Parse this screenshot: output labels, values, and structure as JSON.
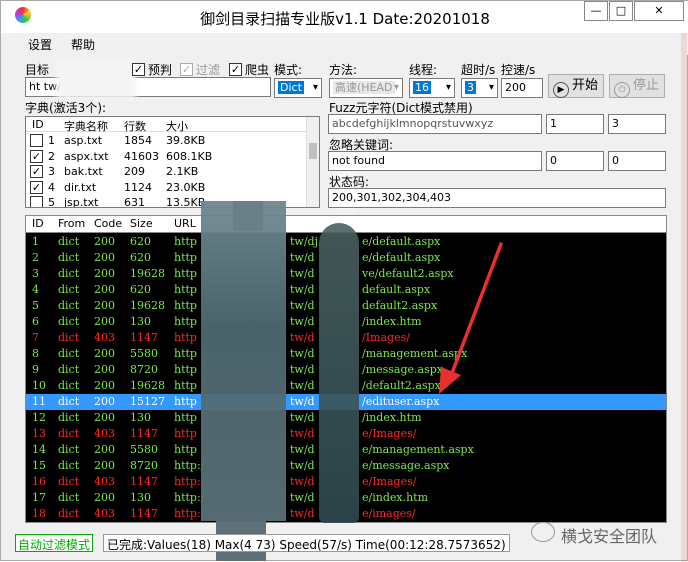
{
  "window": {
    "title": "御剑目录扫描专业版v1.1 Date:20201018",
    "min": "—",
    "max": "□",
    "close": "✕"
  },
  "menu": [
    "设置",
    "帮助"
  ],
  "target": {
    "label": "目标",
    "value": "ht                                    tw/djactive/"
  },
  "options": {
    "predict": "预判",
    "filter": "过滤",
    "crawler": "爬虫",
    "mode_label": "模式:",
    "mode_value": "Dict",
    "method_label": "方法:",
    "method_value": "高速(HEAD",
    "threads_label": "线程:",
    "threads_value": "16",
    "timeout_label": "超时/s",
    "timeout_value": "3",
    "speed_label": "控速/s",
    "speed_value": "200"
  },
  "buttons": {
    "start": "开始",
    "stop": "停止"
  },
  "dict": {
    "label": "字典(激活3个):",
    "columns": [
      "ID",
      "字典名称",
      "行数",
      "大小"
    ],
    "rows": [
      {
        "checked": false,
        "id": "1",
        "name": "asp.txt",
        "lines": "1854",
        "size": "39.8KB"
      },
      {
        "checked": true,
        "id": "2",
        "name": "aspx.txt",
        "lines": "41603",
        "size": "608.1KB"
      },
      {
        "checked": true,
        "id": "3",
        "name": "bak.txt",
        "lines": "209",
        "size": "2.1KB"
      },
      {
        "checked": true,
        "id": "4",
        "name": "dir.txt",
        "lines": "1124",
        "size": "23.0KB"
      },
      {
        "checked": false,
        "id": "5",
        "name": "jsp.txt",
        "lines": "631",
        "size": "13.5KB"
      }
    ]
  },
  "fuzz": {
    "label": "Fuzz元字符(Dict模式禁用)",
    "value": "abcdefghijklmnopqrstuvwxyz",
    "min": "1",
    "max": "3"
  },
  "ignore": {
    "label": "忽略关键词:",
    "value": "not found",
    "a": "0",
    "b": "0"
  },
  "status_codes": {
    "label": "状态码:",
    "value": "200,301,302,304,403"
  },
  "results": {
    "columns": [
      "ID",
      "From",
      "Code",
      "Size",
      "URL"
    ],
    "selected_id": "11",
    "rows": [
      {
        "id": "1",
        "from": "dict",
        "code": "200",
        "size": "620",
        "url_a": "http",
        "url_b": "tw/dj",
        "url_c": "e/default.aspx"
      },
      {
        "id": "2",
        "from": "dict",
        "code": "200",
        "size": "620",
        "url_a": "http",
        "url_b": "tw/d",
        "url_c": "e/default.aspx"
      },
      {
        "id": "3",
        "from": "dict",
        "code": "200",
        "size": "19628",
        "url_a": "http",
        "url_b": "tw/d",
        "url_c": "ve/default2.aspx"
      },
      {
        "id": "4",
        "from": "dict",
        "code": "200",
        "size": "620",
        "url_a": "http",
        "url_b": "tw/d",
        "url_c": "default.aspx"
      },
      {
        "id": "5",
        "from": "dict",
        "code": "200",
        "size": "19628",
        "url_a": "http",
        "url_b": "tw/d",
        "url_c": "default2.aspx"
      },
      {
        "id": "6",
        "from": "dict",
        "code": "200",
        "size": "130",
        "url_a": "http",
        "url_b": "tw/d",
        "url_c": "/index.htm"
      },
      {
        "id": "7",
        "from": "dict",
        "code": "403",
        "size": "1147",
        "url_a": "http",
        "url_b": "tw/d",
        "url_c": "/Images/"
      },
      {
        "id": "8",
        "from": "dict",
        "code": "200",
        "size": "5580",
        "url_a": "http",
        "url_b": "tw/d",
        "url_c": "/management.aspx"
      },
      {
        "id": "9",
        "from": "dict",
        "code": "200",
        "size": "8720",
        "url_a": "http",
        "url_b": "tw/d",
        "url_c": "/message.aspx"
      },
      {
        "id": "10",
        "from": "dict",
        "code": "200",
        "size": "19628",
        "url_a": "http",
        "url_b": "tw/d",
        "url_c": "/default2.aspx"
      },
      {
        "id": "11",
        "from": "dict",
        "code": "200",
        "size": "15127",
        "url_a": "http",
        "url_b": "tw/d",
        "url_c": "/edituser.aspx"
      },
      {
        "id": "12",
        "from": "dict",
        "code": "200",
        "size": "130",
        "url_a": "http",
        "url_b": "tw/d",
        "url_c": "/index.htm"
      },
      {
        "id": "13",
        "from": "dict",
        "code": "403",
        "size": "1147",
        "url_a": "http",
        "url_b": "tw/d",
        "url_c": "e/Images/"
      },
      {
        "id": "14",
        "from": "dict",
        "code": "200",
        "size": "5580",
        "url_a": "http",
        "url_b": "tw/d",
        "url_c": "e/management.aspx"
      },
      {
        "id": "15",
        "from": "dict",
        "code": "200",
        "size": "8720",
        "url_a": "http:/",
        "url_b": "tw/d",
        "url_c": "e/message.aspx"
      },
      {
        "id": "16",
        "from": "dict",
        "code": "403",
        "size": "1147",
        "url_a": "http:/",
        "url_b": "tw/d",
        "url_c": "e/Images/"
      },
      {
        "id": "17",
        "from": "dict",
        "code": "200",
        "size": "130",
        "url_a": "http:/",
        "url_b": "tw/d",
        "url_c": "e/index.htm"
      },
      {
        "id": "18",
        "from": "dict",
        "code": "403",
        "size": "1147",
        "url_a": "http:/",
        "url_b": "tw/d",
        "url_c": "e/images/"
      }
    ]
  },
  "status": {
    "mode": "自动过滤模式",
    "text": "已完成:Values(18) Max(4  73) Speed(57/s) Time(00:12:28.7573652)"
  },
  "watermark": "横戈安全团队",
  "colors": {
    "ok": "#7ee84b",
    "forbidden": "#ff2a2a",
    "selected_bg": "#3399ff",
    "arrow": "#e8312f"
  }
}
